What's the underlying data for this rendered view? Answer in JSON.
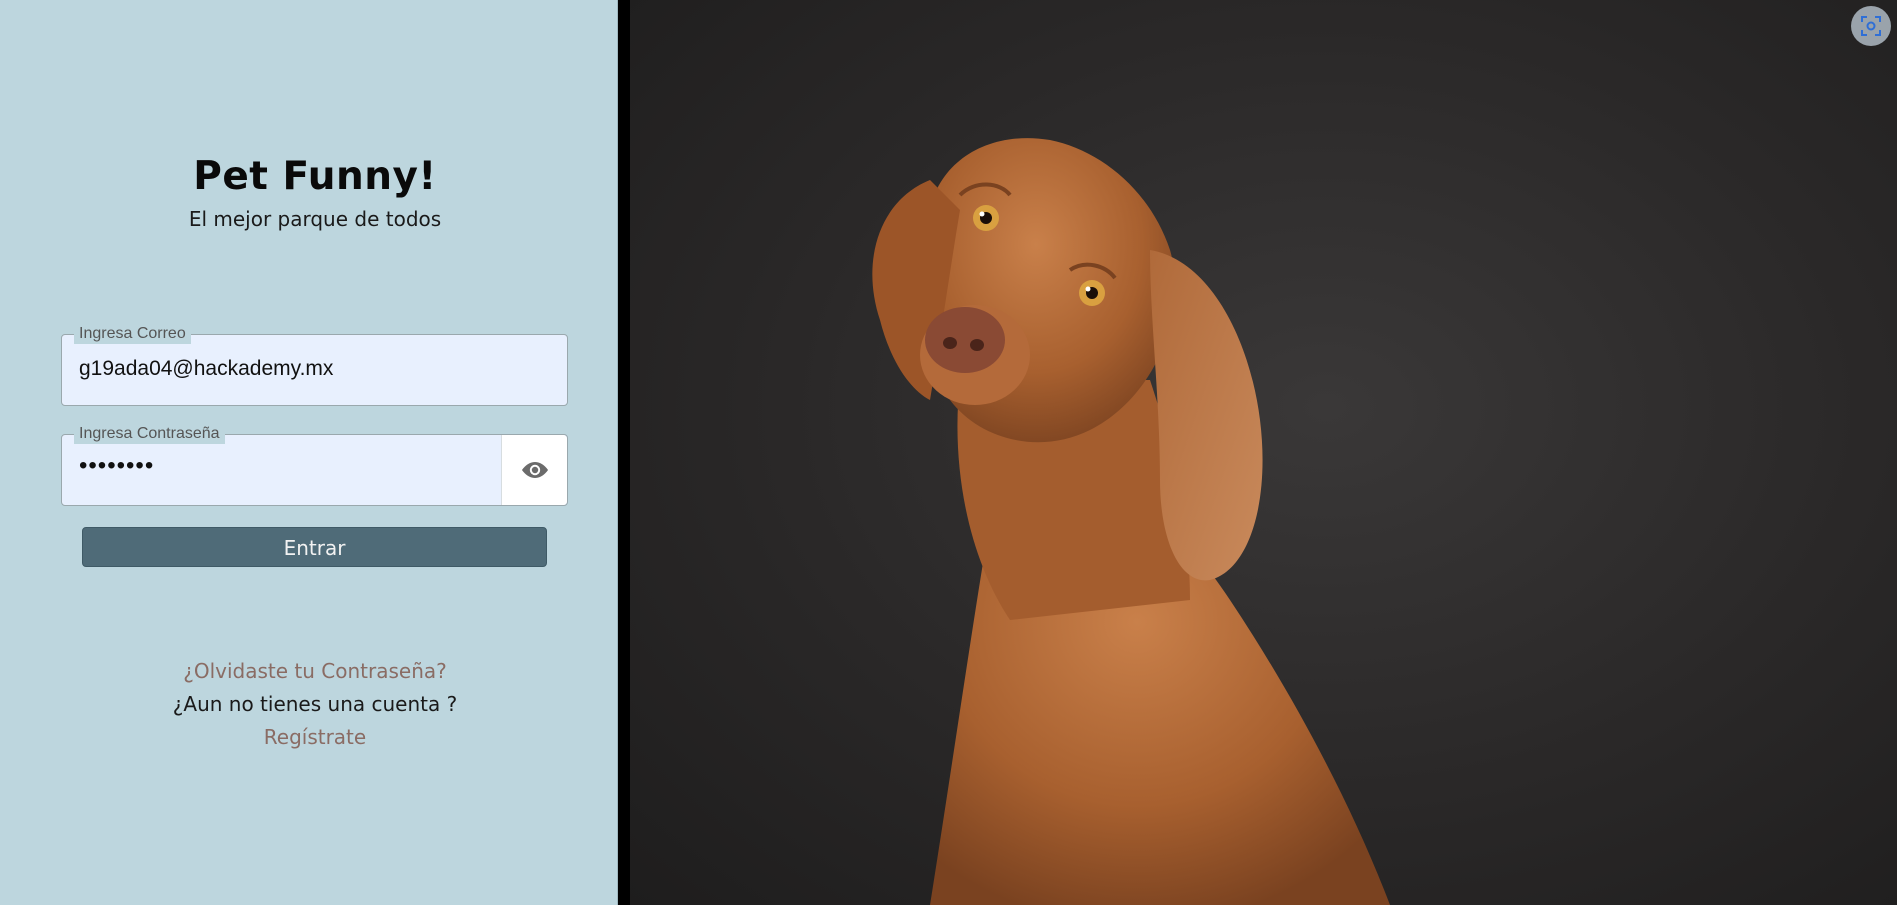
{
  "app": {
    "title": "Pet Funny!",
    "subtitle": "El mejor parque de todos"
  },
  "login": {
    "email_label": "Ingresa Correo",
    "email_value": "g19ada04@hackademy.mx",
    "password_label": "Ingresa Contraseña",
    "password_value": "••••••••",
    "submit_label": "Entrar"
  },
  "links": {
    "forgot_password": "¿Olvidaste tu Contraseña?",
    "no_account": "¿Aun no tienes una cuenta ?",
    "register": "Regístrate"
  },
  "icons": {
    "password_toggle": "eye-icon",
    "screen_capture": "scan-icon",
    "hero": "dog-photo"
  },
  "colors": {
    "panel_bg": "#bdd6de",
    "input_bg": "#e8f0fe",
    "button_bg": "#4f6b78",
    "link_color": "#8a6c64"
  }
}
